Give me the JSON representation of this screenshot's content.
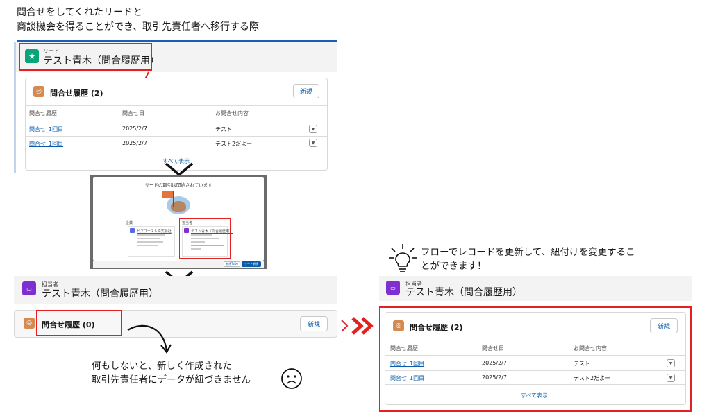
{
  "title": {
    "line1": "問合せをしてくれたリードと",
    "line2": "商談機会を得ることができ、取引先責任者へ移行する際"
  },
  "lead_panel": {
    "object_label": "リード",
    "record_name": "テスト青木（問合履歴用）",
    "icon": "star-icon",
    "color": "#09a57a"
  },
  "related_list": {
    "title": "問合せ履歴 (2)",
    "new_button": "新規",
    "columns": [
      "問合せ履歴",
      "問合せ日",
      "お問合せ内容"
    ],
    "rows": [
      {
        "name": "問合せ_1回目",
        "date": "2025/2/7",
        "content": "テスト"
      },
      {
        "name": "問合せ_1回目",
        "date": "2025/2/7",
        "content": "テスト2だよー"
      }
    ],
    "view_all": "すべて表示"
  },
  "convert_modal": {
    "title": "リードの取引は開始されています",
    "account_section": "企業",
    "contact_section": "担当者",
    "account_name": "ビズブースト株式会社",
    "contact_name": "テスト青木（問合履歴用）",
    "button_secondary": "新規ToDo",
    "button_primary": "リード新規"
  },
  "contact_panel": {
    "object_label": "担当者",
    "record_name": "テスト青木（問合履歴用）",
    "icon": "contact-card-icon",
    "color": "#7f2ed1",
    "related_title_empty": "問合せ履歴 (0)",
    "new_button": "新規"
  },
  "note_bottom": {
    "line1": "何もしないと、新しく作成された",
    "line2": "取引先責任者にデータが紐づきません"
  },
  "note_right": {
    "line1": "フローでレコードを更新して、紐付けを変更するこ",
    "line2": "とができます！"
  },
  "right_panel": {
    "object_label": "担当者",
    "record_name": "テスト青木（問合履歴用）"
  },
  "colors": {
    "accent_red": "#e42120",
    "link_blue": "#0b5cab",
    "card_icon": "#d68a4f"
  }
}
